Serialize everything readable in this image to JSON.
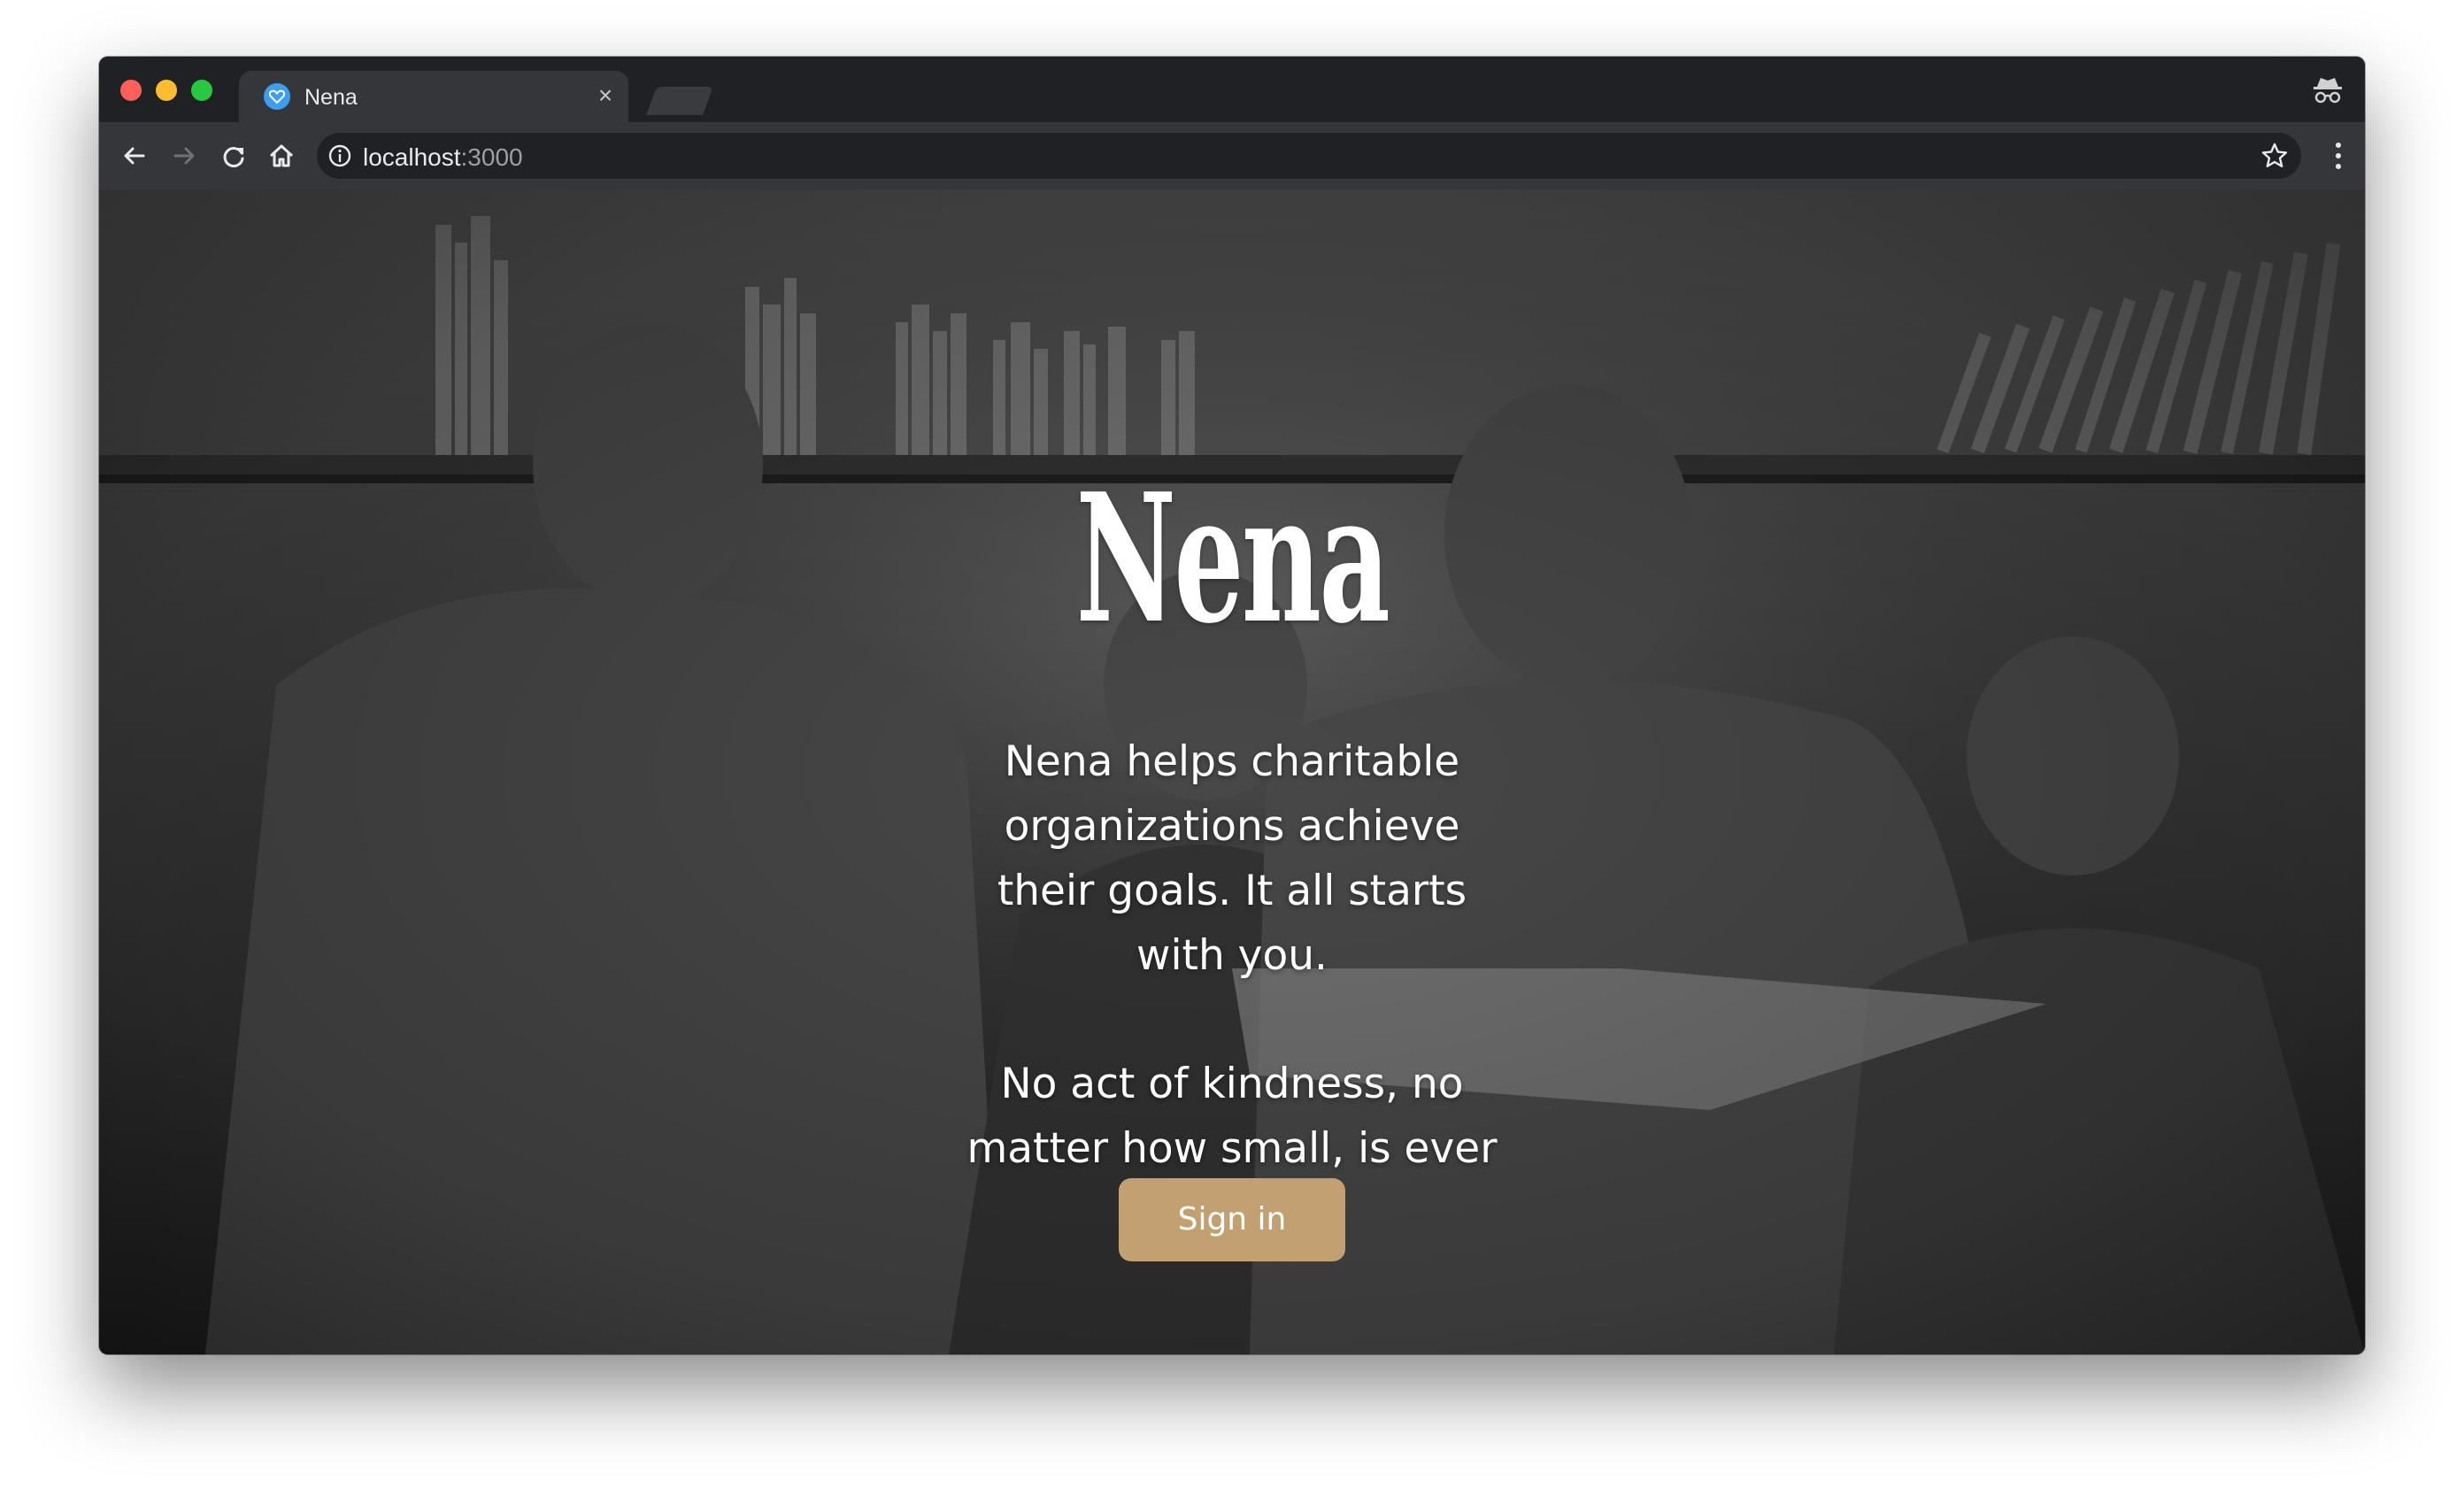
{
  "browser": {
    "tab": {
      "title": "Nena",
      "favicon": "heart-icon",
      "close_glyph": "×"
    },
    "toolbar": {
      "url_host": "localhost",
      "url_port": ":3000"
    },
    "icons": [
      "back-arrow-icon",
      "forward-arrow-icon",
      "reload-icon",
      "home-icon",
      "info-icon",
      "star-icon",
      "menu-dots-icon",
      "incognito-icon"
    ]
  },
  "page": {
    "logo": "Nena",
    "tagline_1": "Nena helps charitable organizations achieve their goals. It all starts with you.",
    "tagline_2": "No act of kindness, no matter how small, is ever wasted.",
    "signin_label": "Sign in",
    "background": "black-and-white photo of volunteers reading a book with two children in front of a bookshelf"
  },
  "colors": {
    "accent": "#c2a071",
    "tab_bar": "#202124",
    "toolbar": "#35363a",
    "traffic_red": "#fe5f57",
    "traffic_yellow": "#febc2e",
    "traffic_green": "#28c840"
  }
}
